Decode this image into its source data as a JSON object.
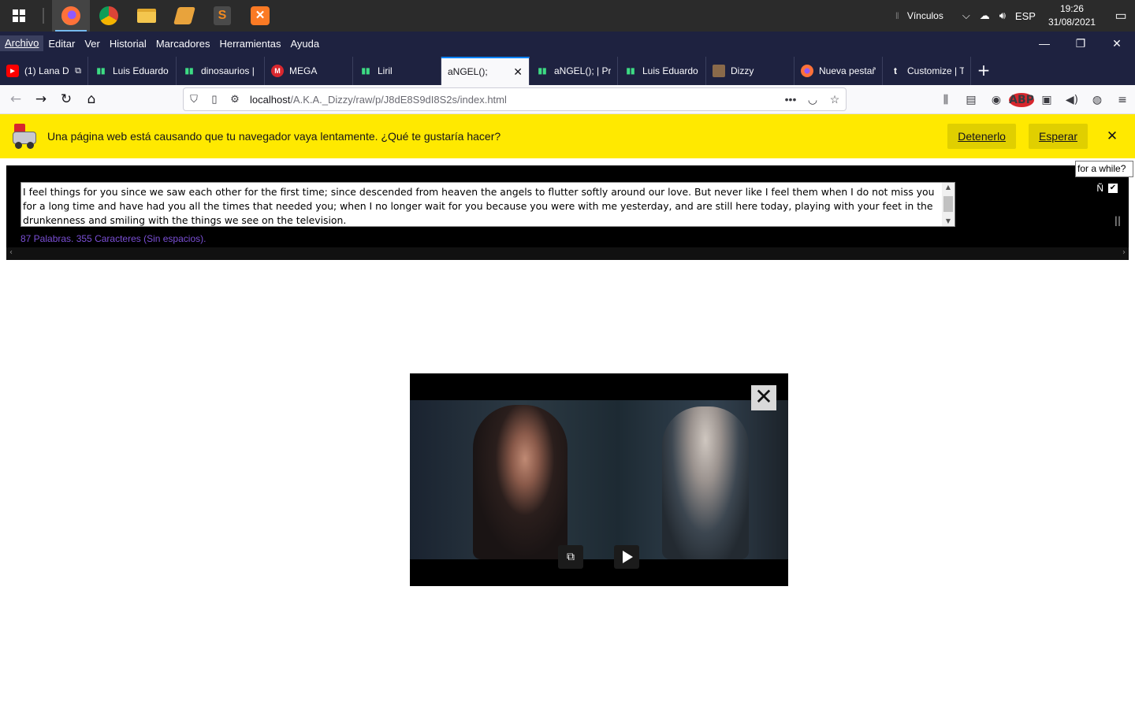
{
  "taskbar": {
    "apps": [
      {
        "name": "firefox-icon",
        "color": "#ff7139",
        "active": true
      },
      {
        "name": "chrome-icon",
        "color": "#4285f4"
      },
      {
        "name": "file-explorer-icon",
        "color": "#f4c64e"
      },
      {
        "name": "winamp-icon",
        "color": "#e8a33c"
      },
      {
        "name": "sublime-text-icon",
        "color": "#f28a1f"
      },
      {
        "name": "xampp-icon",
        "color": "#fb7a24"
      }
    ],
    "vinculos": "Vínculos",
    "language": "ESP",
    "time": "19:26",
    "date": "31/08/2021"
  },
  "menu": [
    "Archivo",
    "Editar",
    "Ver",
    "Historial",
    "Marcadores",
    "Herramientas",
    "Ayuda"
  ],
  "tabs": [
    {
      "label": "(1) Lana D",
      "icon": "youtube-icon",
      "color": "#ff0000"
    },
    {
      "label": "Luis Eduardo",
      "icon": "audio-bars-icon",
      "color": "#3ddc84"
    },
    {
      "label": "dinosaurios |",
      "icon": "audio-bars-icon",
      "color": "#3ddc84"
    },
    {
      "label": "MEGA",
      "icon": "mega-icon",
      "color": "#d9272e"
    },
    {
      "label": "Liril",
      "icon": "audio-bars-icon",
      "color": "#3ddc84"
    },
    {
      "label": "aNGEL();",
      "icon": "none",
      "active": true
    },
    {
      "label": "aNGEL(); | Pr",
      "icon": "audio-bars-icon",
      "color": "#3ddc84"
    },
    {
      "label": "Luis Eduardo",
      "icon": "audio-bars-icon",
      "color": "#3ddc84"
    },
    {
      "label": "Dizzy",
      "icon": "image-icon",
      "color": "#8a6a4a"
    },
    {
      "label": "Nueva pestañ",
      "icon": "firefox-icon",
      "color": "#ff7139"
    },
    {
      "label": "Customize | T",
      "icon": "tumblr-icon",
      "color": "#001935"
    }
  ],
  "url": {
    "host": "localhost",
    "path": "/A.K.A._Dizzy/raw/p/J8dE8S9dI8S2s/index.html"
  },
  "notification": {
    "text": "Una página web está causando que tu navegador vaya lentamente. ¿Qué te gustaría hacer?",
    "stop_label": "Detenerlo",
    "wait_label": "Esperar"
  },
  "editor": {
    "text": "I feel things for you since we saw each other for the first time; since descended from heaven the angels to flutter softly around our love. But never like I feel them when I do not miss you for a long time and have had you all the times that needed you; when I no longer wait for you because you were with me yesterday, and are still here today, playing with your feet in the drunkenness and smiling with the things we see on the television.",
    "counter": "87 Palabras. 355 Caracteres (Sin espacios).",
    "right_char": "Ñ",
    "tooltip": "for a while?"
  },
  "video": {
    "state": "paused"
  }
}
